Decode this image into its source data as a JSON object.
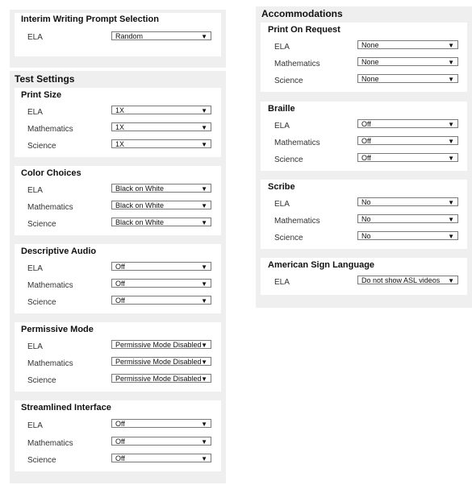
{
  "interim": {
    "title": "Interim Writing Prompt Selection",
    "rows": [
      {
        "label": "ELA",
        "value": "Random"
      }
    ]
  },
  "test_settings": {
    "title": "Test Settings",
    "sections": [
      {
        "title": "Print Size",
        "rows": [
          {
            "label": "ELA",
            "value": "1X"
          },
          {
            "label": "Mathematics",
            "value": "1X"
          },
          {
            "label": "Science",
            "value": "1X"
          }
        ]
      },
      {
        "title": "Color Choices",
        "rows": [
          {
            "label": "ELA",
            "value": "Black on White"
          },
          {
            "label": "Mathematics",
            "value": "Black on White"
          },
          {
            "label": "Science",
            "value": "Black on White"
          }
        ]
      },
      {
        "title": "Descriptive Audio",
        "rows": [
          {
            "label": "ELA",
            "value": "Off"
          },
          {
            "label": "Mathematics",
            "value": "Off"
          },
          {
            "label": "Science",
            "value": "Off"
          }
        ]
      },
      {
        "title": "Permissive Mode",
        "rows": [
          {
            "label": "ELA",
            "value": "Permissive Mode Disabled"
          },
          {
            "label": "Mathematics",
            "value": "Permissive Mode Disabled"
          },
          {
            "label": "Science",
            "value": "Permissive Mode Disabled"
          }
        ]
      },
      {
        "title": "Streamlined Interface",
        "rows": [
          {
            "label": "ELA",
            "value": "Off"
          },
          {
            "label": "Mathematics",
            "value": "Off"
          },
          {
            "label": "Science",
            "value": "Off"
          }
        ]
      }
    ]
  },
  "accommodations": {
    "title": "Accommodations",
    "sections": [
      {
        "title": "Print On Request",
        "rows": [
          {
            "label": "ELA",
            "value": "None"
          },
          {
            "label": "Mathematics",
            "value": "None"
          },
          {
            "label": "Science",
            "value": "None"
          }
        ]
      },
      {
        "title": "Braille",
        "rows": [
          {
            "label": "ELA",
            "value": "Off"
          },
          {
            "label": "Mathematics",
            "value": "Off"
          },
          {
            "label": "Science",
            "value": "Off"
          }
        ]
      },
      {
        "title": "Scribe",
        "rows": [
          {
            "label": "ELA",
            "value": "No"
          },
          {
            "label": "Mathematics",
            "value": "No"
          },
          {
            "label": "Science",
            "value": "No"
          }
        ]
      },
      {
        "title": "American Sign Language",
        "rows": [
          {
            "label": "ELA",
            "value": "Do not show ASL videos"
          }
        ]
      }
    ]
  },
  "icons": {
    "dropdown": "chevron-down-icon"
  }
}
